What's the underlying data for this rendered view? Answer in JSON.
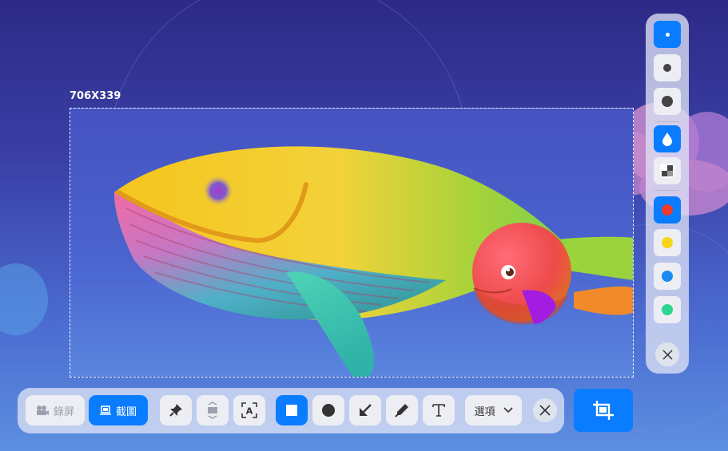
{
  "selection": {
    "size_label": "706X339"
  },
  "toolbar": {
    "record_label": "錄屏",
    "screenshot_label": "截圖",
    "options_label": "選項",
    "tools": [
      {
        "name": "pin-icon"
      },
      {
        "name": "scroll-capture-icon"
      },
      {
        "name": "ocr-icon"
      },
      {
        "name": "rectangle-icon"
      },
      {
        "name": "ellipse-icon"
      },
      {
        "name": "arrow-icon"
      },
      {
        "name": "pencil-icon"
      },
      {
        "name": "text-icon"
      }
    ],
    "close_icon": "close-icon",
    "capture_icon": "crop-icon"
  },
  "side_panel": {
    "brush_sizes": [
      "small",
      "medium",
      "large"
    ],
    "effects": [
      "blur-icon",
      "mosaic-icon"
    ],
    "colors": [
      "#ee3b2b",
      "#f7d51c",
      "#1a8cf0",
      "#2bd58f"
    ],
    "accent": "#0a7cff"
  }
}
